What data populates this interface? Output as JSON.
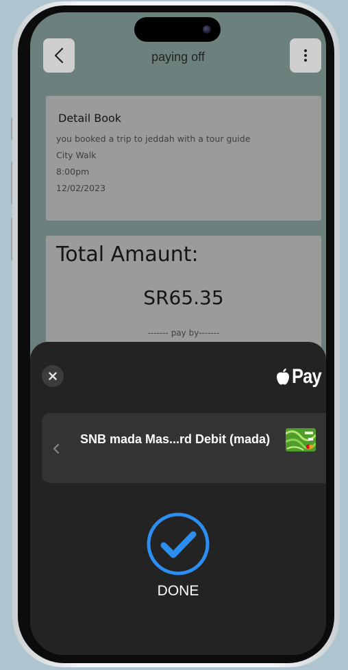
{
  "header": {
    "title": "paying off"
  },
  "detail": {
    "title": "Detail Book",
    "lines": [
      "you booked a trip to jeddah with a tour guide",
      "City Walk",
      "8:00pm",
      "12/02/2023"
    ]
  },
  "total": {
    "label": "Total Amaunt:",
    "amount": "SR65.35",
    "pay_by": "------- pay by-------"
  },
  "payment_sheet": {
    "brand": "Pay",
    "card_name": "SNB mada Mas...rd Debit (mada)",
    "status": "DONE"
  },
  "colors": {
    "accent": "#2b8ef0",
    "sheet": "#232323",
    "card_row": "#343434",
    "app_bg": "#6c807d",
    "info_card": "#9a9c9b"
  }
}
